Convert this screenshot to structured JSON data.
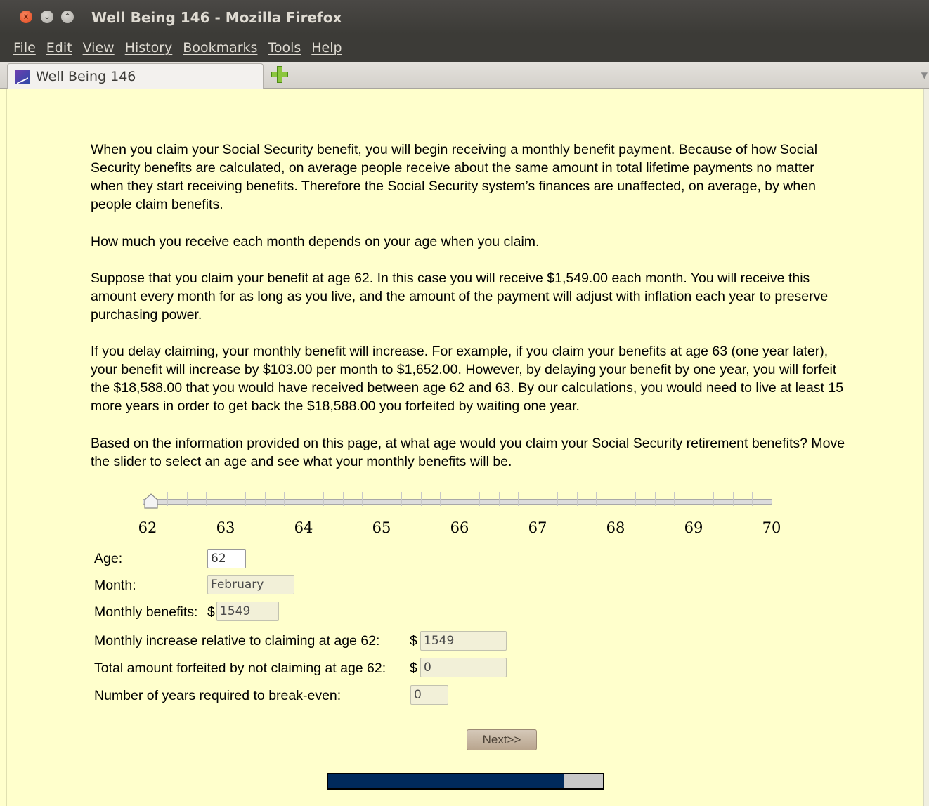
{
  "window": {
    "title": "Well Being 146 - Mozilla Firefox",
    "close_glyph": "×",
    "min_glyph": "⌄",
    "max_glyph": "⌃"
  },
  "menu": [
    "File",
    "Edit",
    "View",
    "History",
    "Bookmarks",
    "Tools",
    "Help"
  ],
  "tab": {
    "label": "Well Being 146",
    "list_arrow": "▼"
  },
  "paragraphs": [
    "When you claim your Social Security benefit, you will begin receiving a monthly benefit payment. Because of how Social Security benefits are calculated, on average people receive about the same amount in total lifetime payments no matter when they start receiving benefits. Therefore the Social Security system’s finances are unaffected, on average, by when people claim benefits.",
    "How much you receive each month depends on your age when you claim.",
    "Suppose that you claim your benefit at age 62. In this case you will receive $1,549.00 each month. You will receive this amount every month for as long as you live, and the amount of the payment will adjust with inflation each year to preserve purchasing power.",
    "If you delay claiming, your monthly benefit will increase. For example, if you claim your benefits at age 63 (one year later), your benefit will increase by $103.00 per month to $1,652.00. However, by delaying your benefit by one year, you will forfeit the $18,588.00 that you would have received between age 62 and 63. By our calculations, you would need to live at least 15 more years in order to get back the $18,588.00 you forfeited by waiting one year.",
    "Based on the information provided on this page, at what age would you claim your Social Security retirement benefits? Move the slider to select an age and see what your monthly benefits will be."
  ],
  "slider": {
    "min": 62,
    "max": 70,
    "value": 62,
    "tick_labels": [
      "62",
      "63",
      "64",
      "65",
      "66",
      "67",
      "68",
      "69",
      "70"
    ]
  },
  "form": {
    "age_label": "Age:",
    "age_value": "62",
    "month_label": "Month:",
    "month_value": "February",
    "monthly_benefits_label": "Monthly benefits:",
    "monthly_benefits_value": "1549",
    "increase_label": "Monthly increase relative to claiming at age 62:",
    "increase_value": "1549",
    "forfeited_label": "Total amount forfeited by not claiming at age 62:",
    "forfeited_value": "0",
    "breakeven_label": "Number of years required to break-even:",
    "breakeven_value": "0",
    "currency": "$"
  },
  "next_button": "Next>>",
  "progress": {
    "fraction": 0.86
  }
}
